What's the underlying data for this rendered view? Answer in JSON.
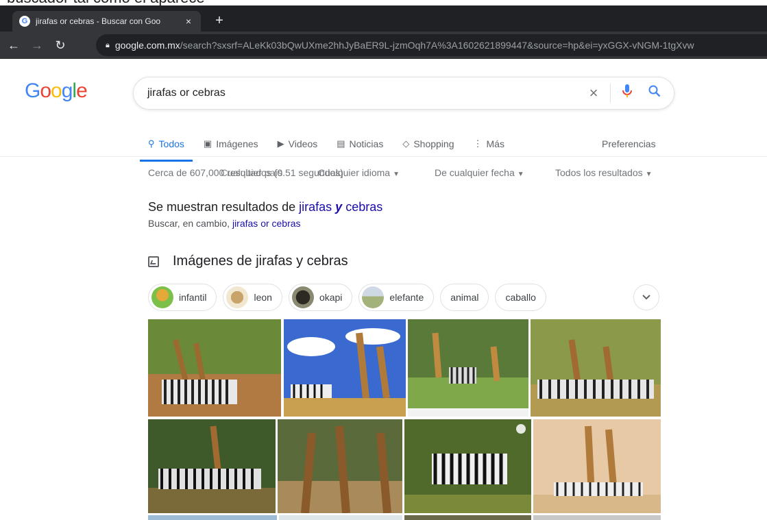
{
  "browser": {
    "tab_title": "jirafas or cebras - Buscar con Goo",
    "tab_close": "×",
    "new_tab": "+",
    "url_domain": "google.com.mx",
    "url_path": "/search?sxsrf=ALeKk03bQwUXme2hhJyBaER9L-jzmOqh7A%3A1602621899447&source=hp&ei=yxGGX-vNGM-1tgXvw",
    "top_strip_text": "buscador tal como el aparece"
  },
  "search": {
    "logo": "Google",
    "query": "jirafas or cebras",
    "clear_icon": "×"
  },
  "tabs": [
    {
      "label": "Todos",
      "icon": "search-icon",
      "glyph": "⚲"
    },
    {
      "label": "Imágenes",
      "icon": "image-icon",
      "glyph": "▣"
    },
    {
      "label": "Videos",
      "icon": "play-icon",
      "glyph": "▶"
    },
    {
      "label": "Noticias",
      "icon": "news-icon",
      "glyph": "▤"
    },
    {
      "label": "Shopping",
      "icon": "tag-icon",
      "glyph": "◇"
    },
    {
      "label": "Más",
      "icon": "more-icon",
      "glyph": "⋮"
    }
  ],
  "preferences": "Preferencias",
  "tools": {
    "results_overlap": "Cerca de 607,000 resultados (0.51 segundos)",
    "country": "Cualquier país",
    "language": "Cualquier idioma",
    "date": "De cualquier fecha",
    "all_results": "Todos los resultados"
  },
  "correction": {
    "prefix": "Se muestran resultados de ",
    "term1": "jirafas",
    "conj": "y",
    "term2": "cebras",
    "instead_prefix": "Buscar, en cambio, ",
    "instead_link": "jirafas or cebras"
  },
  "images_section": {
    "heading": "Imágenes de jirafas y cebras",
    "chips": [
      {
        "label": "infantil",
        "thumb_color": "#7cc04a",
        "has_thumb": true
      },
      {
        "label": "leon",
        "thumb_color": "#c9a46a",
        "has_thumb": true
      },
      {
        "label": "okapi",
        "thumb_color": "#3a3a2e",
        "has_thumb": true
      },
      {
        "label": "elefante",
        "thumb_color": "#a3b27a",
        "has_thumb": true
      },
      {
        "label": "animal",
        "has_thumb": false
      },
      {
        "label": "caballo",
        "has_thumb": false
      }
    ],
    "expand_icon": "chevron-down-icon"
  },
  "colors": {
    "blue": "#4285f4",
    "red": "#ea4335",
    "yellow": "#fbbc05",
    "green": "#34a853",
    "link": "#1a0dab",
    "active_tab": "#1a73e8"
  }
}
